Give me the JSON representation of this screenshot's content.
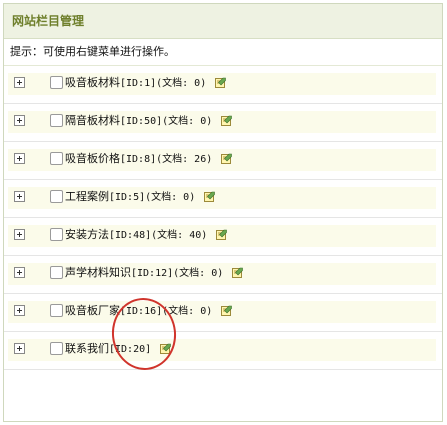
{
  "panel": {
    "title": "网站栏目管理",
    "hint": "提示：可使用右键菜单进行操作。"
  },
  "categories": [
    {
      "name": "吸音板材料",
      "id_text": "[ID:1]",
      "docs_text": "(文档: 0)"
    },
    {
      "name": "隔音板材料",
      "id_text": "[ID:50]",
      "docs_text": "(文档: 0)"
    },
    {
      "name": "吸音板价格",
      "id_text": "[ID:8]",
      "docs_text": "(文档: 26)"
    },
    {
      "name": "工程案例",
      "id_text": "[ID:5]",
      "docs_text": "(文档: 0)"
    },
    {
      "name": "安装方法",
      "id_text": "[ID:48]",
      "docs_text": "(文档: 40)"
    },
    {
      "name": "声学材料知识",
      "id_text": "[ID:12]",
      "docs_text": "(文档: 0)"
    },
    {
      "name": "吸音板厂家",
      "id_text": "[ID:16]",
      "docs_text": "(文档: 0)"
    },
    {
      "name": "联系我们",
      "id_text": "[ID:20]",
      "docs_text": ""
    }
  ],
  "colors": {
    "title_text": "#6e7f2b",
    "title_bg": "#eef2e2",
    "row_bg": "#fbfbea",
    "annotation": "#d0342c"
  },
  "icons": {
    "expand": "plus-box-icon",
    "edit": "edit-note-icon"
  }
}
